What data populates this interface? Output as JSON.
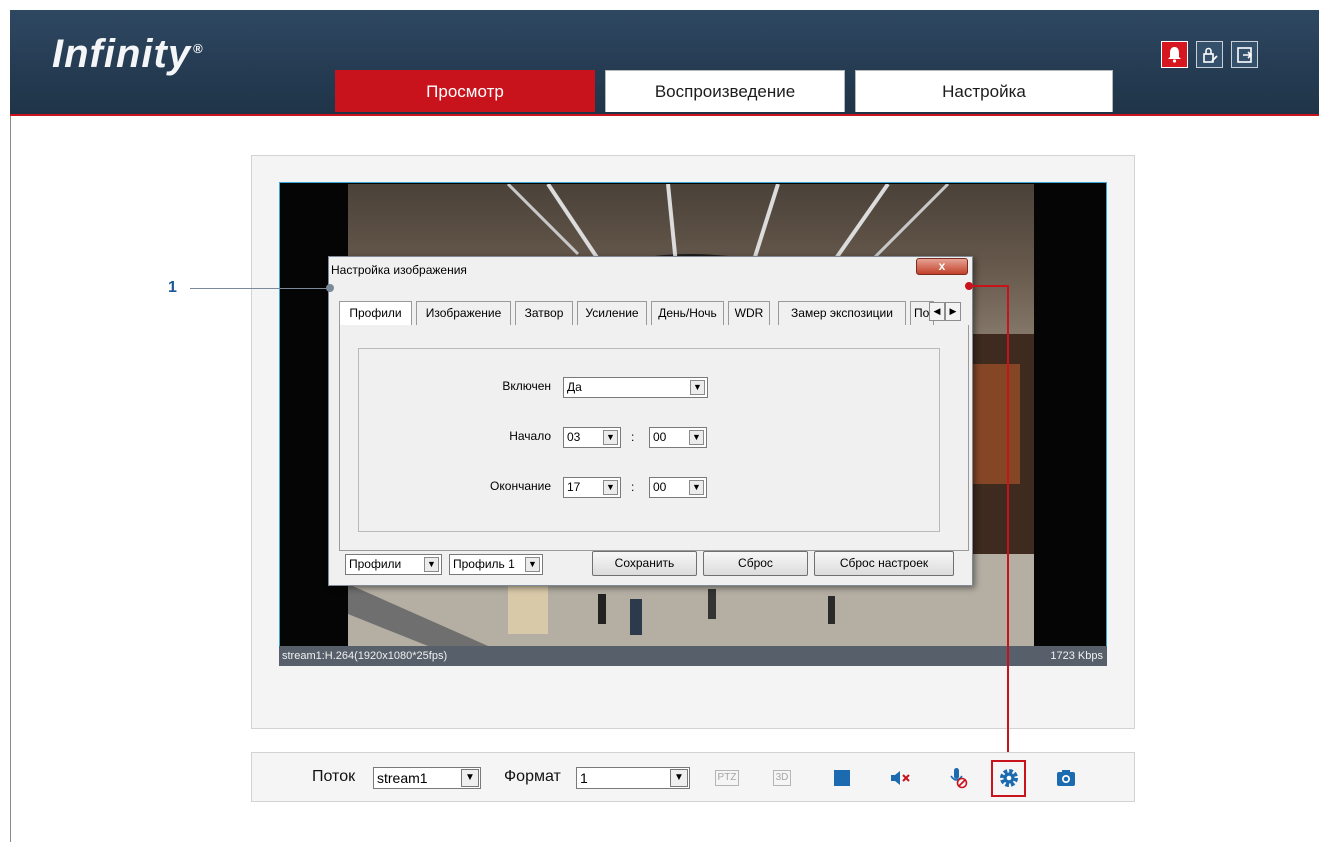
{
  "header": {
    "logo": "Infinity",
    "logo_mark": "®",
    "tabs": [
      {
        "label": "Просмотр",
        "active": true
      },
      {
        "label": "Воспроизведение",
        "active": false
      },
      {
        "label": "Настройка",
        "active": false
      }
    ],
    "icons": [
      "alarm-icon",
      "password-edit-icon",
      "logout-icon"
    ]
  },
  "video": {
    "stream_info": "stream1:H.264(1920x1080*25fps)",
    "bitrate": "1723 Kbps"
  },
  "dialog": {
    "title": "Настройка изображения",
    "close_label": "x",
    "tabs": [
      "Профили",
      "Изображение",
      "Затвор",
      "Усиление",
      "День/Ночь",
      "WDR",
      "Замер экспозиции",
      "По"
    ],
    "fields": {
      "enabled_label": "Включен",
      "enabled_value": "Да",
      "start_label": "Начало",
      "start_hour": "03",
      "start_min": "00",
      "end_label": "Окончание",
      "end_hour": "17",
      "end_min": "00",
      "colon": ":"
    },
    "bottom": {
      "mode_select": "Профили",
      "profile_select": "Профиль 1",
      "save": "Сохранить",
      "reset": "Сброс",
      "reset_defaults": "Сброс настроек"
    }
  },
  "annotation": {
    "number": "1"
  },
  "toolbar": {
    "stream_label": "Поток",
    "stream_value": "stream1",
    "format_label": "Формат",
    "format_value": "1",
    "ptz_label": "PTZ",
    "threed_label": "3D"
  },
  "colors": {
    "accent": "#c9131c",
    "header": "#2a4158",
    "link": "#1c6ab0"
  }
}
